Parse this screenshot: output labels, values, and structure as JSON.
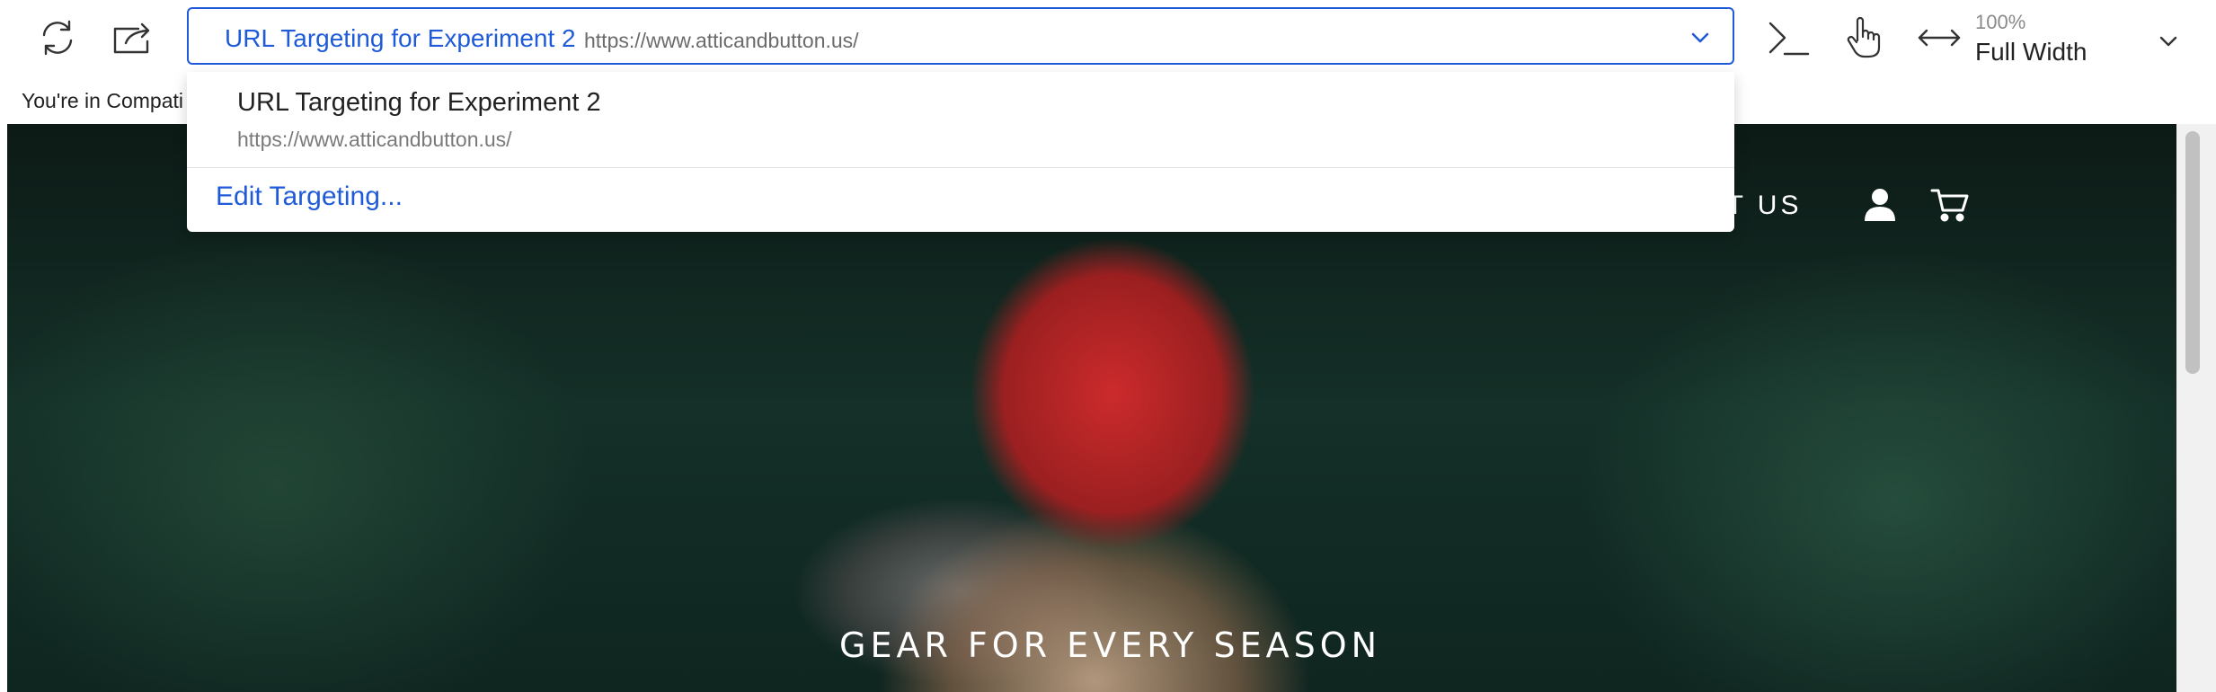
{
  "toolbar": {
    "refresh_icon": "refresh-icon",
    "open_external_icon": "open-external-icon",
    "experiment_selector": {
      "name": "URL Targeting for Experiment 2",
      "url": "https://www.atticandbutton.us/"
    },
    "console_icon": "terminal-icon",
    "interact_icon": "pointer-hand-icon",
    "width_icon": "horizontal-resize-icon",
    "zoom": {
      "percent": "100%",
      "width": "Full Width"
    }
  },
  "compat_notice": "You're in Compati",
  "dropdown": {
    "items": [
      {
        "name": "URL Targeting for Experiment 2",
        "url": "https://www.atticandbutton.us/"
      }
    ],
    "edit_label": "Edit Targeting..."
  },
  "preview": {
    "nav_about": "UT US",
    "hero_text": "GEAR FOR EVERY SEASON"
  },
  "colors": {
    "accent": "#1f5bd8",
    "text": "#222222",
    "muted": "#7a7a7a"
  }
}
